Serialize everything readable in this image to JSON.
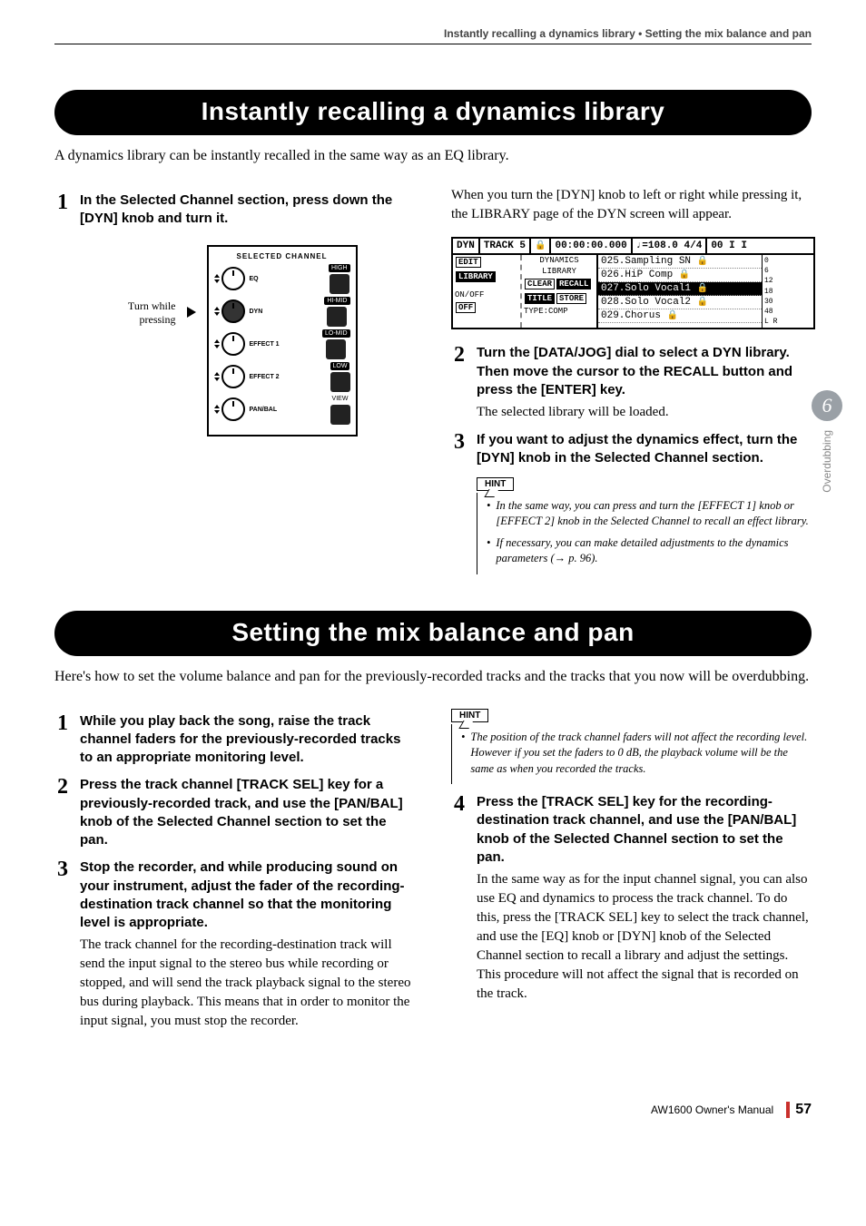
{
  "running_head": "Instantly recalling a dynamics library  •  Setting the mix balance and pan",
  "side_tab": {
    "chapter_num": "6",
    "chapter_name": "Overdubbing"
  },
  "sec1": {
    "title": "Instantly recalling a dynamics library",
    "intro": "A dynamics library can be instantly recalled in the same way as an EQ library.",
    "step1_head": "In the Selected Channel section, press down the [DYN] knob and turn it.",
    "fig_caption": "Turn while pressing",
    "panel": {
      "header": "SELECTED CHANNEL",
      "rows": [
        {
          "knob": "EQ",
          "btn": "HIGH"
        },
        {
          "knob": "DYN",
          "btn": "HI-MID"
        },
        {
          "knob": "EFFECT 1",
          "btn": "LO-MID"
        },
        {
          "knob": "EFFECT 2",
          "btn": "LOW"
        },
        {
          "knob": "PAN/BAL",
          "btn": "VIEW"
        }
      ]
    },
    "right_intro": "When you turn the [DYN] knob to left or right while pressing it, the LIBRARY page of the DYN screen will appear.",
    "screen": {
      "top": {
        "name": "DYN",
        "track": "TRACK  5",
        "lock": "🔒",
        "time": "00:00:00.000",
        "tempo": "♩=108.0 4/4",
        "meter": "00 I I"
      },
      "left_tabs": {
        "t1": "EDIT",
        "t2": "LIBRARY",
        "t3": "ON/OFF",
        "t4": "OFF"
      },
      "mid": {
        "line1": "DYNAMICS",
        "line2": "LIBRARY",
        "btns1a": "CLEAR",
        "btns1b": "RECALL",
        "btns2a": "TITLE",
        "btns2b": "STORE",
        "type": "TYPE:COMP"
      },
      "list": [
        "025.Sampling SN",
        "026.HiP Comp",
        "027.Solo Vocal1",
        "028.Solo Vocal2",
        "029.Chorus"
      ],
      "meters": [
        "0",
        "6",
        "12",
        "18",
        "30",
        "48",
        "L R"
      ]
    },
    "step2_head": "Turn the [DATA/JOG] dial to select a DYN library. Then move the cursor to the RECALL button and press the [ENTER] key.",
    "step2_body": "The selected library will be loaded.",
    "step3_head": "If you want to adjust the dynamics effect, turn the [DYN] knob in the Selected Channel section.",
    "hint_label": "HINT",
    "hint1": "In the same way, you can press and turn the [EFFECT 1] knob or [EFFECT 2] knob in the Selected Channel to recall an effect library.",
    "hint2": "If necessary, you can make detailed adjustments to the dynamics parameters (→ p. 96)."
  },
  "sec2": {
    "title": "Setting the mix balance and pan",
    "intro": "Here's how to set the volume balance and pan for the previously-recorded tracks and the tracks that you now will be overdubbing.",
    "step1_head": "While you play back the song, raise the track channel faders for the previously-recorded tracks to an appropriate monitoring level.",
    "step2_head": "Press the track channel [TRACK SEL] key for a previously-recorded track, and use the [PAN/BAL] knob of the Selected Channel section to set the pan.",
    "step3_head": "Stop the recorder, and while producing sound on your instrument, adjust the fader of the recording-destination track channel so that the monitoring level is appropriate.",
    "step3_body": "The track channel for the recording-destination track will send the input signal to the stereo bus while recording or stopped, and will send the track playback signal to the stereo bus during playback. This means that in order to monitor the input signal, you must stop the recorder.",
    "hint_label": "HINT",
    "hint1": "The position of the track channel faders will not affect the recording level. However if you set the faders to 0 dB, the playback volume will be the same as when you recorded the tracks.",
    "step4_head": "Press the [TRACK SEL] key for the recording-destination track channel, and use the [PAN/BAL] knob of the Selected Channel section to set the pan.",
    "step4_body": "In the same way as for the input channel signal, you can also use EQ and dynamics to process the track channel. To do this, press the [TRACK SEL] key to select the track channel, and use the [EQ] knob or [DYN] knob of the Selected Channel section to recall a library and adjust the settings. This procedure will not affect the signal that is recorded on the track."
  },
  "footer": {
    "manual": "AW1600  Owner's Manual",
    "page": "57"
  }
}
